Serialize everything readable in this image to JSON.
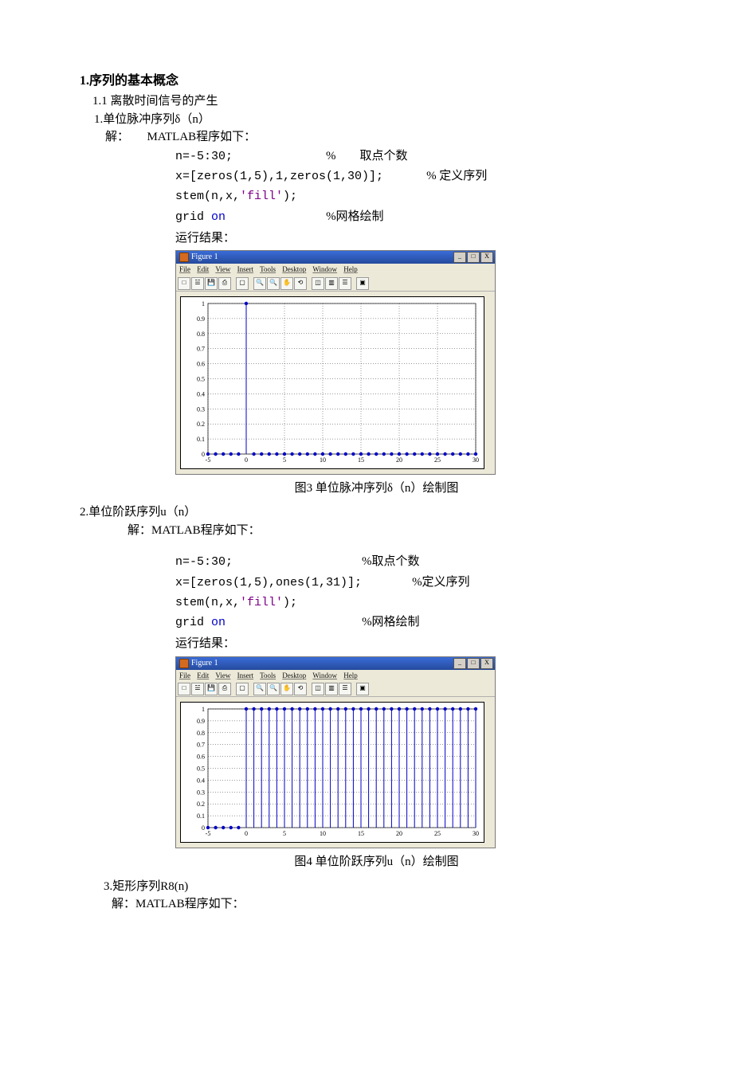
{
  "h1": "1.序列的基本概念",
  "h1_1": "1.1  离散时间信号的产生",
  "sec1": {
    "title": "1.单位脉冲序列δ（n）",
    "solution": "解：　　MATLAB程序如下：",
    "code": {
      "l1": "n=-5:30;",
      "c1": "%　　取点个数",
      "l2": "x=[zeros(1,5),1,zeros(1,30)];",
      "c2": "% 定义序列",
      "l3a": "stem(n,x,",
      "l3b": "'fill'",
      "l3c": ");",
      "l4a": "grid ",
      "l4b": "on",
      "c4": "%网格绘制"
    },
    "run": "运行结果：",
    "caption": "图3 单位脉冲序列δ（n）绘制图"
  },
  "sec2": {
    "title": "2.单位阶跃序列u（n）",
    "solution": "解：MATLAB程序如下：",
    "code": {
      "l1": "n=-5:30;",
      "c1": "%取点个数",
      "l2": "x=[zeros(1,5),ones(1,31)];",
      "c2": "%定义序列",
      "l3a": "stem(n,x,",
      "l3b": "'fill'",
      "l3c": ");",
      "l4a": "grid ",
      "l4b": "on",
      "c4": "%网格绘制"
    },
    "run": "运行结果：",
    "caption": "图4 单位阶跃序列u（n）绘制图"
  },
  "sec3": {
    "title": "3.矩形序列R8(n)",
    "solution": "解：MATLAB程序如下："
  },
  "figwin": {
    "title": "Figure 1",
    "menu": {
      "file": "File",
      "edit": "Edit",
      "view": "View",
      "insert": "Insert",
      "tools": "Tools",
      "desktop": "Desktop",
      "window": "Window",
      "help": "Help"
    },
    "min": "_",
    "max": "□",
    "close": "X"
  },
  "chart_data": [
    {
      "type": "stem",
      "title": "",
      "xlim": [
        -5,
        30
      ],
      "ylim": [
        0,
        1
      ],
      "xticks": [
        -5,
        0,
        5,
        10,
        15,
        20,
        25,
        30
      ],
      "yticks": [
        0,
        0.1,
        0.2,
        0.3,
        0.4,
        0.5,
        0.6,
        0.7,
        0.8,
        0.9,
        1
      ],
      "x": [
        -5,
        -4,
        -3,
        -2,
        -1,
        0,
        1,
        2,
        3,
        4,
        5,
        6,
        7,
        8,
        9,
        10,
        11,
        12,
        13,
        14,
        15,
        16,
        17,
        18,
        19,
        20,
        21,
        22,
        23,
        24,
        25,
        26,
        27,
        28,
        29,
        30
      ],
      "y": [
        0,
        0,
        0,
        0,
        0,
        1,
        0,
        0,
        0,
        0,
        0,
        0,
        0,
        0,
        0,
        0,
        0,
        0,
        0,
        0,
        0,
        0,
        0,
        0,
        0,
        0,
        0,
        0,
        0,
        0,
        0,
        0,
        0,
        0,
        0,
        0
      ]
    },
    {
      "type": "stem",
      "title": "",
      "xlim": [
        -5,
        30
      ],
      "ylim": [
        0,
        1
      ],
      "xticks": [
        -5,
        0,
        5,
        10,
        15,
        20,
        25,
        30
      ],
      "yticks": [
        0,
        0.1,
        0.2,
        0.3,
        0.4,
        0.5,
        0.6,
        0.7,
        0.8,
        0.9,
        1
      ],
      "x": [
        -5,
        -4,
        -3,
        -2,
        -1,
        0,
        1,
        2,
        3,
        4,
        5,
        6,
        7,
        8,
        9,
        10,
        11,
        12,
        13,
        14,
        15,
        16,
        17,
        18,
        19,
        20,
        21,
        22,
        23,
        24,
        25,
        26,
        27,
        28,
        29,
        30
      ],
      "y": [
        0,
        0,
        0,
        0,
        0,
        1,
        1,
        1,
        1,
        1,
        1,
        1,
        1,
        1,
        1,
        1,
        1,
        1,
        1,
        1,
        1,
        1,
        1,
        1,
        1,
        1,
        1,
        1,
        1,
        1,
        1,
        1,
        1,
        1,
        1,
        1
      ]
    }
  ]
}
